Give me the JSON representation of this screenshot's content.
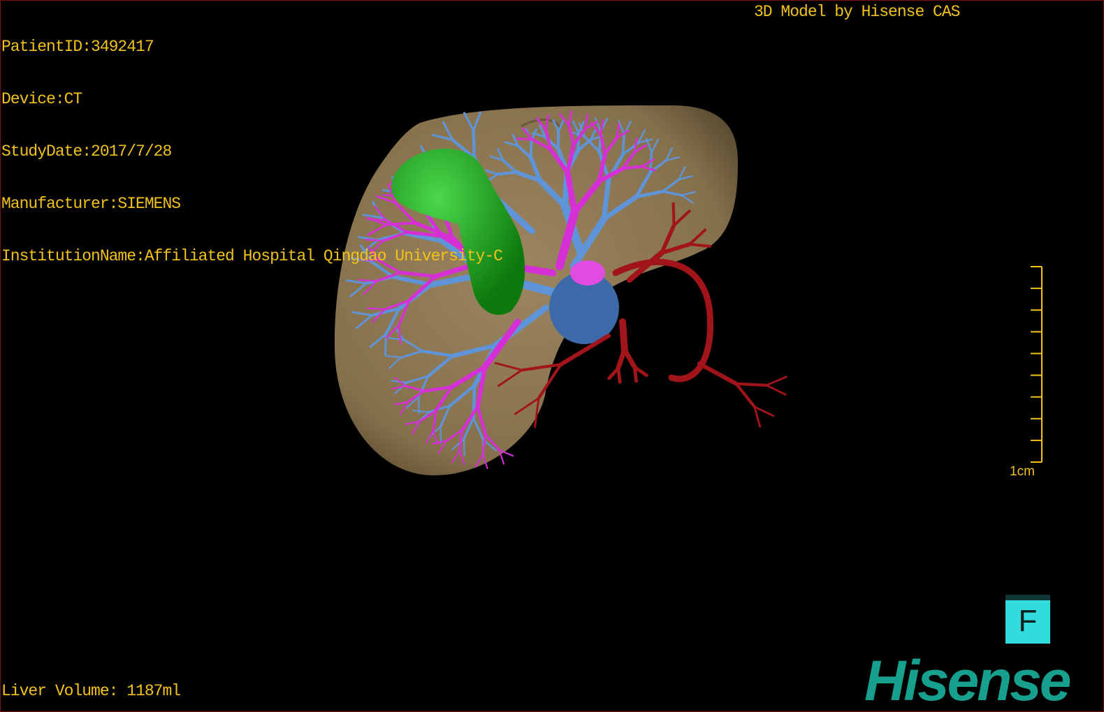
{
  "overlay": {
    "patient_id": "PatientID:3492417",
    "device": "Device:CT",
    "study_date": "StudyDate:2017/7/28",
    "manufacturer": "Manufacturer:SIEMENS",
    "institution": "InstitutionName:Affiliated Hospital Qingdao University-C",
    "brand_text": "3D Model by Hisense CAS",
    "liver_volume": "Liver Volume: 1187ml"
  },
  "scale_bar": {
    "label": "1cm",
    "ticks": 10
  },
  "orientation": {
    "label": "F"
  },
  "logo": {
    "text": "Hisense",
    "color": "#17a08e"
  },
  "colors": {
    "text": "#f2c21a",
    "liver": "#8d7650",
    "gallbladder": "#1fa81f",
    "portal_vein": "#5f95d8",
    "hepatic_vein": "#d62fd6",
    "artery": "#a0141a",
    "ivc": "#3c6aa8"
  }
}
